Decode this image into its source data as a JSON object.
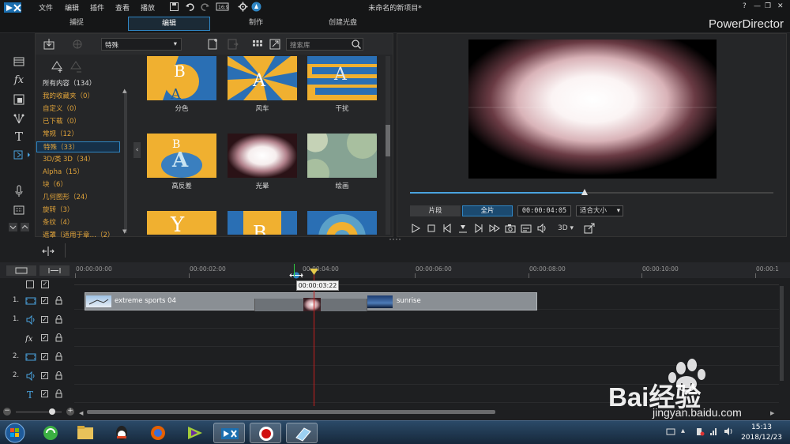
{
  "titlebar": {
    "menus": [
      "文件",
      "编辑",
      "插件",
      "查看",
      "播放"
    ],
    "title": "未命名的新项目*",
    "window_controls": [
      "?",
      "—",
      "❐",
      "✕"
    ]
  },
  "modes": {
    "tabs": [
      "捕捉",
      "编辑",
      "制作",
      "创建光盘"
    ],
    "active": "编辑",
    "brand": "PowerDirector"
  },
  "library": {
    "category_dropdown": "特殊",
    "search_placeholder": "搜索库",
    "categories": [
      {
        "label": "所有内容（134）",
        "type": "all"
      },
      {
        "label": "我的收藏夹（0）",
        "type": "normal"
      },
      {
        "label": "自定义（0）",
        "type": "normal"
      },
      {
        "label": "已下载（0）",
        "type": "normal"
      },
      {
        "label": "常规（12）",
        "type": "normal"
      },
      {
        "label": "特殊（33）",
        "type": "selected"
      },
      {
        "label": "3D/类 3D（34）",
        "type": "normal"
      },
      {
        "label": "Alpha（15）",
        "type": "normal"
      },
      {
        "label": "块（6）",
        "type": "normal"
      },
      {
        "label": "几何图形（24）",
        "type": "normal"
      },
      {
        "label": "旋转（3）",
        "type": "normal"
      },
      {
        "label": "条纹（4）",
        "type": "normal"
      },
      {
        "label": "遮罩（适用于章…（2）",
        "type": "normal"
      }
    ],
    "transitions": [
      {
        "name": "分色",
        "style": "split"
      },
      {
        "name": "风车",
        "style": "windmill"
      },
      {
        "name": "干扰",
        "style": "interference"
      },
      {
        "name": "高反差",
        "style": "contrast"
      },
      {
        "name": "光晕",
        "style": "glow"
      },
      {
        "name": "绘画",
        "style": "paint"
      },
      {
        "name": "",
        "style": "partial1"
      },
      {
        "name": "",
        "style": "partial2"
      },
      {
        "name": "",
        "style": "partial3"
      }
    ]
  },
  "preview": {
    "scrub_position": 0.48,
    "mode_clip": "片段",
    "mode_movie": "全片",
    "timecode": "00:00:04:05",
    "fit_label": "适合大小",
    "mode_3d": "3D"
  },
  "timeline": {
    "ruler_labels": [
      "00:00:00:00",
      "00:00:02:00",
      "00:00:04:00",
      "00:00:06:00",
      "00:00:08:00",
      "00:00:10:00",
      "00:00:1"
    ],
    "playhead_tooltip": "00:00:03:22",
    "tracks": [
      {
        "number": "1.",
        "kind": "video"
      },
      {
        "number": "1.",
        "kind": "audio"
      },
      {
        "number": "",
        "kind": "fx"
      },
      {
        "number": "2.",
        "kind": "video"
      },
      {
        "number": "2.",
        "kind": "audio"
      },
      {
        "number": "",
        "kind": "title"
      }
    ],
    "clips": [
      {
        "label": "extreme sports 04"
      },
      {
        "label": "sunrise"
      }
    ]
  },
  "taskbar": {
    "time": "15:13",
    "date": "2018/12/23"
  },
  "watermark": {
    "text": "Bai经验",
    "url": "jingyan.baidu.com"
  },
  "colors": {
    "accent": "#2f86c4",
    "category_text": "#e0a33a",
    "clip_fill": "#8a8f94",
    "playhead": "#c81e1e"
  }
}
